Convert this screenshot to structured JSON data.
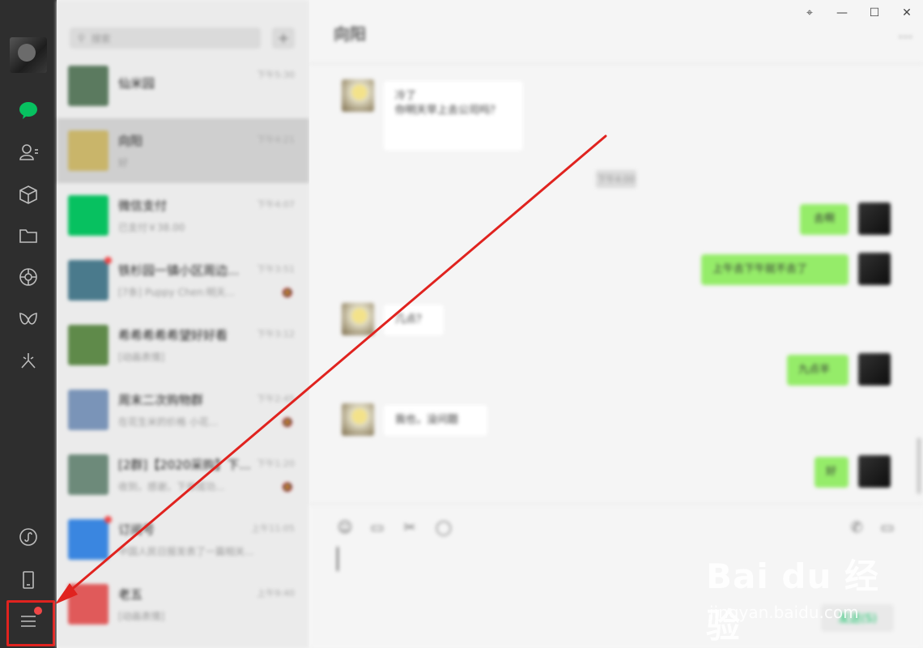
{
  "sidebar": {
    "icons": [
      "chat-icon",
      "contacts-icon",
      "favorites-icon",
      "files-icon",
      "moments-icon",
      "channels-icon",
      "search-icon"
    ],
    "bottom_icons": [
      "mini-program-icon",
      "phone-icon",
      "menu-icon"
    ],
    "accent_color": "#07c160"
  },
  "chatlist": {
    "search_placeholder": "搜索",
    "add_label": "+",
    "items": [
      {
        "name": "仙米园",
        "preview": "",
        "time": "下午5:30",
        "muted": false,
        "badge": false,
        "avatar_color": "#5b7a5f"
      },
      {
        "name": "向阳",
        "preview": "好",
        "time": "下午4:21",
        "muted": false,
        "badge": false,
        "avatar_color": "#c9b56a",
        "active": true
      },
      {
        "name": "微信支付",
        "preview": "已支付￥38.00",
        "time": "下午4:07",
        "muted": false,
        "badge": false,
        "avatar_color": "#07c160"
      },
      {
        "name": "铁杉园一镇小区周边...",
        "preview": "[7条] Puppy Chen:明天...",
        "time": "下午3:51",
        "muted": true,
        "badge": true,
        "avatar_color": "#4a7a8c"
      },
      {
        "name": "希希希希希望好好看",
        "preview": "[动画表情]",
        "time": "下午3:12",
        "muted": false,
        "badge": false,
        "avatar_color": "#5f8a4a"
      },
      {
        "name": "周末二次购物群",
        "preview": "在花生米的价格 小花...",
        "time": "下午2:45",
        "muted": true,
        "badge": false,
        "avatar_color": "#7a94b8"
      },
      {
        "name": "[2群]【2020采购】下...",
        "preview": "收到，感谢，下单成功...",
        "time": "下午1:20",
        "muted": true,
        "badge": false,
        "avatar_color": "#6d8a7a"
      },
      {
        "name": "订阅号",
        "preview": "中国人民日报发表了一篇相关...",
        "time": "上午11:05",
        "muted": false,
        "badge": true,
        "avatar_color": "#3a86e0"
      },
      {
        "name": "老五",
        "preview": "[动画表情]",
        "time": "上午9:40",
        "muted": false,
        "badge": false,
        "avatar_color": "#e05a5a"
      }
    ]
  },
  "chat": {
    "title": "向阳",
    "more_label": "···",
    "time_divider": "下午4:00",
    "messages": [
      {
        "side": "left",
        "text": "冷了\n你明天早上去公司吗？"
      },
      {
        "side": "right",
        "text": "去啊"
      },
      {
        "side": "right",
        "text": "上午去下午就不去了"
      },
      {
        "side": "left",
        "text": "几点？"
      },
      {
        "side": "right",
        "text": "九点半"
      },
      {
        "side": "left",
        "text": "我也，没问题"
      },
      {
        "side": "right",
        "text": "好"
      }
    ],
    "send_label": "发送(S)"
  },
  "window": {
    "pin_label": "⌖",
    "minimize_label": "—",
    "maximize_label": "☐",
    "close_label": "✕"
  },
  "watermark": {
    "logo_text": "Bai du 经验",
    "url": "jingyan.baidu.com"
  },
  "annotation": {
    "highlight_color": "#e0231f"
  }
}
